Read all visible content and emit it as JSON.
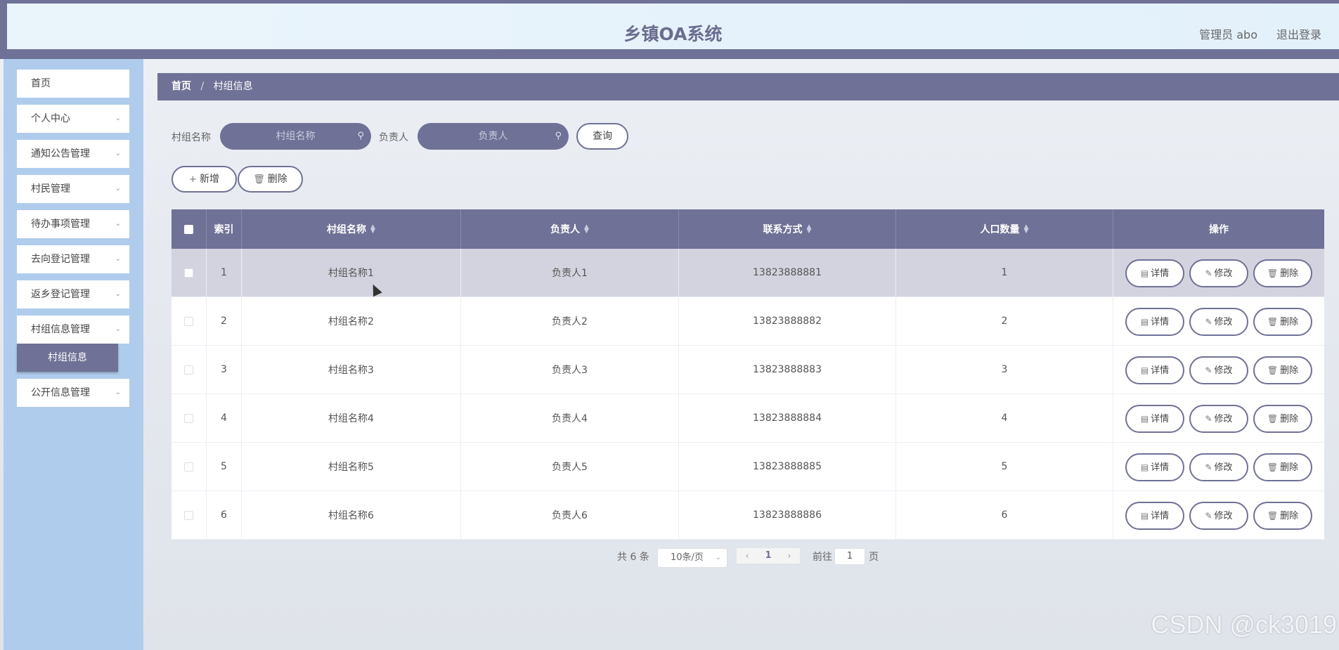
{
  "header": {
    "title": "乡镇OA系统",
    "user": "管理员 abo",
    "logout": "退出登录"
  },
  "sidebar": {
    "items": [
      {
        "label": "首页"
      },
      {
        "label": "个人中心"
      },
      {
        "label": "通知公告管理"
      },
      {
        "label": "村民管理"
      },
      {
        "label": "待办事项管理"
      },
      {
        "label": "去向登记管理"
      },
      {
        "label": "返乡登记管理"
      },
      {
        "label": "村组信息管理"
      },
      {
        "label": "公开信息管理"
      }
    ],
    "active_sub": "村组信息"
  },
  "breadcrumb": {
    "home": "首页",
    "sep": "/",
    "current": "村组信息"
  },
  "search": {
    "name_label": "村组名称",
    "name_placeholder": "村组名称",
    "person_label": "负责人",
    "person_placeholder": "负责人",
    "query_button": "查询"
  },
  "actions": {
    "add": "新增",
    "delete": "删除"
  },
  "table": {
    "columns": [
      "索引",
      "村组名称",
      "负责人",
      "联系方式",
      "人口数量",
      "操作"
    ],
    "rows": [
      {
        "idx": "1",
        "name": "村组名称1",
        "person": "负责人1",
        "phone": "13823888881",
        "pop": "1"
      },
      {
        "idx": "2",
        "name": "村组名称2",
        "person": "负责人2",
        "phone": "13823888882",
        "pop": "2"
      },
      {
        "idx": "3",
        "name": "村组名称3",
        "person": "负责人3",
        "phone": "13823888883",
        "pop": "3"
      },
      {
        "idx": "4",
        "name": "村组名称4",
        "person": "负责人4",
        "phone": "13823888884",
        "pop": "4"
      },
      {
        "idx": "5",
        "name": "村组名称5",
        "person": "负责人5",
        "phone": "13823888885",
        "pop": "5"
      },
      {
        "idx": "6",
        "name": "村组名称6",
        "person": "负责人6",
        "phone": "13823888886",
        "pop": "6"
      }
    ],
    "row_actions": {
      "detail": "详情",
      "edit": "修改",
      "delete": "删除"
    }
  },
  "pagination": {
    "total": "共 6 条",
    "page_size": "10条/页",
    "current_page": "1",
    "goto_label": "前往",
    "goto_value": "1",
    "page_unit": "页"
  },
  "watermark": "CSDN @ck3019"
}
